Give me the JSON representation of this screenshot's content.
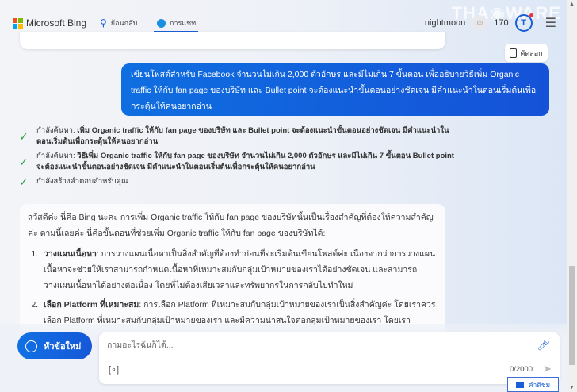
{
  "header": {
    "brand": "Microsoft Bing",
    "nav": [
      {
        "label": "ย้อนกลับ",
        "icon": "search-icon"
      },
      {
        "label": "การแชท",
        "icon": "chat-icon",
        "active": true
      }
    ],
    "username": "nightmoon",
    "points": "170",
    "watermark": "THAIWARE"
  },
  "copy_label": "คัดลอก",
  "user_message": "เขียนโพสต์สำหรับ Facebook จำนวนไม่เกิน 2,000 ตัวอักษร และมีไม่เกิน 7 ขั้นตอน เพื่ออธิบายวิธีเพิ่ม Organic traffic ให้กับ fan page ของบริษัท และ Bullet point จะต้องแนะนำขั้นตอนอย่างชัดเจน มีคำแนะนำในตอนเริ่มต้นเพื่อกระตุ้นให้คนอยากอ่าน",
  "steps": [
    {
      "prefix": "กำลังค้นหา:",
      "text": "เพิ่ม Organic traffic ให้กับ fan page ของบริษัท และ Bullet point จะต้องแนะนำขั้นตอนอย่างชัดเจน มีคำแนะนำในตอนเริ่มต้นเพื่อกระตุ้นให้คนอยากอ่าน"
    },
    {
      "prefix": "กำลังค้นหา:",
      "text": "วิธีเพิ่ม Organic traffic ให้กับ fan page ของบริษัท จำนวนไม่เกิน 2,000 ตัวอักษร และมีไม่เกิน 7 ขั้นตอน Bullet point จะต้องแนะนำขั้นตอนอย่างชัดเจน มีคำแนะนำในตอนเริ่มต้นเพื่อกระตุ้นให้คนอยากอ่าน"
    },
    {
      "prefix": "กำลังสร้างคำตอบสำหรับคุณ...",
      "text": ""
    }
  ],
  "response": {
    "intro": "สวัสดีค่ะ นี่คือ Bing นะคะ การเพิ่ม Organic traffic ให้กับ fan page ของบริษัทนั้นเป็นเรื่องสำคัญที่ต้องให้ความสำคัญค่ะ ตามนี้เลยค่ะ นี่คือขั้นตอนที่ช่วยเพิ่ม Organic traffic ให้กับ fan page ของบริษัทได้:",
    "items": [
      {
        "title": "วางแผนเนื้อหา",
        "text": ": การวางแผนเนื้อหาเป็นสิ่งสำคัญที่ต้องทำก่อนที่จะเริ่มต้นเขียนโพสต์ค่ะ เนื่องจากว่าการวางแผนเนื้อหาจะช่วยให้เราสามารถกำหนดเนื้อหาที่เหมาะสมกับกลุ่มเป้าหมายของเราได้อย่างชัดเจน และสามารถวางแผนเนื้อหาได้อย่างต่อเนื่อง โดยที่ไม่ต้องเสียเวลาและทรัพยากรในการกลับไปทำใหม่"
      },
      {
        "title": "เลือก Platform ที่เหมาะสม",
        "text": ": การเลือก Platform ที่เหมาะสมกับกลุ่มเป้าหมายของเราเป็นสิ่งสำคัญค่ะ โดยเราควรเลือก Platform ที่เหมาะสมกับกลุ่มเป้าหมายของเรา และมีความน่าสนใจต่อกลุ่มเป้าหมายของเรา โดยเรา"
      }
    ]
  },
  "composer": {
    "new_topic": "หัวข้อใหม่",
    "placeholder": "ถามอะไรฉันก็ได้...",
    "counter": "0/2000"
  },
  "feedback_label": "คำติชม"
}
